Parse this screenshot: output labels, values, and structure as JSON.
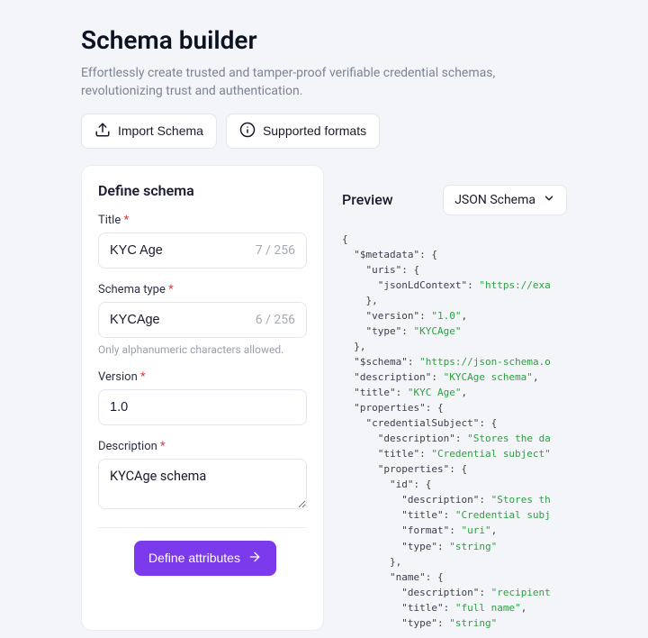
{
  "header": {
    "title": "Schema builder",
    "subtitle": "Effortlessly create trusted and tamper-proof verifiable credential schemas, revolutionizing trust and authentication."
  },
  "actions": {
    "import": "Import Schema",
    "supported": "Supported formats"
  },
  "form": {
    "heading": "Define schema",
    "title_label": "Title",
    "title_value": "KYC Age",
    "title_counter": "7 / 256",
    "type_label": "Schema type",
    "type_value": "KYCAge",
    "type_counter": "6 / 256",
    "type_hint": "Only alphanumeric characters allowed.",
    "version_label": "Version",
    "version_value": "1.0",
    "description_label": "Description",
    "description_value": "KYCAge schema",
    "submit": "Define attributes"
  },
  "preview": {
    "heading": "Preview",
    "format": "JSON Schema",
    "code": {
      "l1": "{",
      "l2a": "  \"$metadata\"",
      "l2b": ": {",
      "l3a": "    \"uris\"",
      "l3b": ": {",
      "l4a": "      \"jsonLdContext\"",
      "l4b": ": ",
      "l4c": "\"https://exa",
      "l5": "    },",
      "l6a": "    \"version\"",
      "l6b": ": ",
      "l6c": "\"1.0\"",
      "l6d": ",",
      "l7a": "    \"type\"",
      "l7b": ": ",
      "l7c": "\"KYCAge\"",
      "l8": "  },",
      "l9a": "  \"$schema\"",
      "l9b": ": ",
      "l9c": "\"https://json-schema.o",
      "l10a": "  \"description\"",
      "l10b": ": ",
      "l10c": "\"KYCAge schema\"",
      "l10d": ",",
      "l11a": "  \"title\"",
      "l11b": ": ",
      "l11c": "\"KYC Age\"",
      "l11d": ",",
      "l12a": "  \"properties\"",
      "l12b": ": {",
      "l13a": "    \"credentialSubject\"",
      "l13b": ": {",
      "l14a": "      \"description\"",
      "l14b": ": ",
      "l14c": "\"Stores the da",
      "l15a": "      \"title\"",
      "l15b": ": ",
      "l15c": "\"Credential subject\"",
      "l16a": "      \"properties\"",
      "l16b": ": {",
      "l17a": "        \"id\"",
      "l17b": ": {",
      "l18a": "          \"description\"",
      "l18b": ": ",
      "l18c": "\"Stores th",
      "l19a": "          \"title\"",
      "l19b": ": ",
      "l19c": "\"Credential subj",
      "l20a": "          \"format\"",
      "l20b": ": ",
      "l20c": "\"uri\"",
      "l20d": ",",
      "l21a": "          \"type\"",
      "l21b": ": ",
      "l21c": "\"string\"",
      "l22": "        },",
      "l23a": "        \"name\"",
      "l23b": ": {",
      "l24a": "          \"description\"",
      "l24b": ": ",
      "l24c": "\"recipient",
      "l25a": "          \"title\"",
      "l25b": ": ",
      "l25c": "\"full name\"",
      "l25d": ",",
      "l26a": "          \"type\"",
      "l26b": ": ",
      "l26c": "\"string\""
    }
  }
}
